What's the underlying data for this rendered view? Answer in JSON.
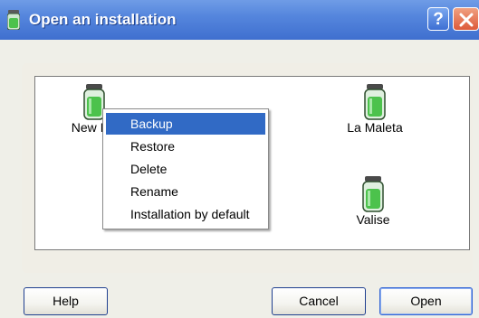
{
  "window": {
    "title": "Open an installation",
    "help_glyph": "?",
    "close_icon": "close-icon",
    "title_icon": "jar-icon"
  },
  "installations": [
    {
      "label": "New Ins",
      "icon": "jar-icon"
    },
    {
      "label": "La Maleta",
      "icon": "jar-icon"
    },
    {
      "label": "Valise",
      "icon": "jar-icon"
    }
  ],
  "context_menu": {
    "items": [
      {
        "label": "Backup",
        "selected": true
      },
      {
        "label": "Restore",
        "selected": false
      },
      {
        "label": "Delete",
        "selected": false
      },
      {
        "label": "Rename",
        "selected": false
      },
      {
        "label": "Installation by default",
        "selected": false
      }
    ]
  },
  "buttons": {
    "help": "Help",
    "cancel": "Cancel",
    "open": "Open"
  },
  "colors": {
    "titlebar": "#3f6fcf",
    "selection": "#316ac5",
    "jar_green": "#4cc24c"
  }
}
